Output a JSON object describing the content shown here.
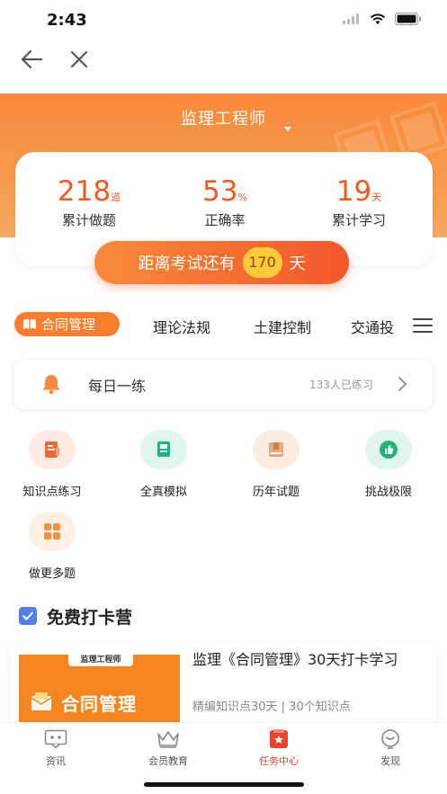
{
  "status_bar": {
    "time": "2:43"
  },
  "header": {
    "exam_title": "监理工程师"
  },
  "stats": [
    {
      "value": "218",
      "unit": "道",
      "label": "累计做题"
    },
    {
      "value": "53",
      "unit": "%",
      "label": "正确率"
    },
    {
      "value": "19",
      "unit": "天",
      "label": "累计学习"
    }
  ],
  "countdown": {
    "prefix": "距离考试还有",
    "days": "170",
    "suffix": "天"
  },
  "tabs": [
    {
      "label": "合同管理",
      "active": true
    },
    {
      "label": "理论法规"
    },
    {
      "label": "土建控制"
    },
    {
      "label": "交通投"
    }
  ],
  "daily": {
    "label": "每日一练",
    "count": "133人已练习"
  },
  "grid": [
    {
      "label": "知识点练习",
      "icon": "doc-icon"
    },
    {
      "label": "全真模拟",
      "icon": "exam-icon"
    },
    {
      "label": "历年试题",
      "icon": "box-icon"
    },
    {
      "label": "挑战极限",
      "icon": "thumbs-up-icon"
    },
    {
      "label": "做更多题",
      "icon": "apps-icon"
    }
  ],
  "section": {
    "title": "免费打卡营"
  },
  "camp": {
    "badge": "监理工程师",
    "image_title": "合同管理",
    "title": "监理《合同管理》30天打卡学习",
    "subtitle": "精编知识点30天 | 30个知识点"
  },
  "tabbar": [
    {
      "label": "资讯",
      "icon": "chat-icon"
    },
    {
      "label": "会员教育",
      "icon": "crown-icon"
    },
    {
      "label": "任务中心",
      "icon": "task-icon",
      "active": true
    },
    {
      "label": "发现",
      "icon": "discover-icon"
    }
  ],
  "colors": {
    "accent": "#f97d2e",
    "stat_orange": "#f05a23",
    "active_tab_red": "#e8432e"
  }
}
